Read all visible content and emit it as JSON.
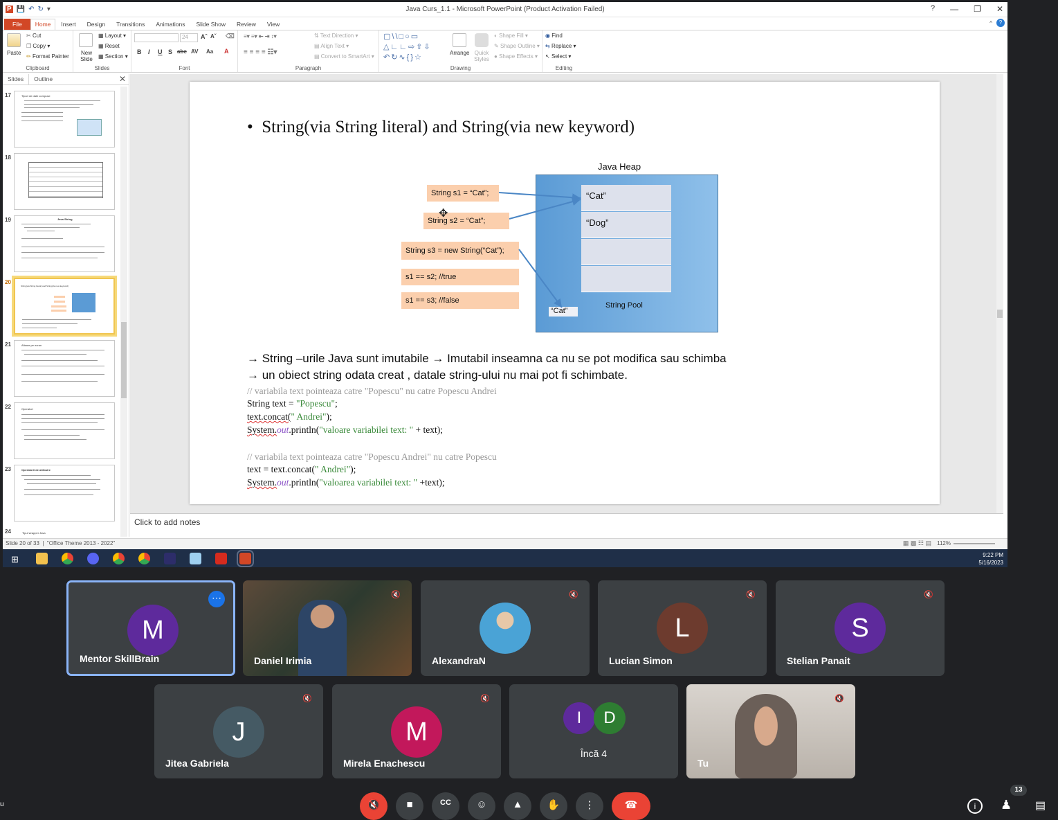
{
  "window": {
    "title": "Java Curs_1.1 - Microsoft PowerPoint (Product Activation Failed)"
  },
  "ribbon": {
    "tabs": [
      "File",
      "Home",
      "Insert",
      "Design",
      "Transitions",
      "Animations",
      "Slide Show",
      "Review",
      "View"
    ],
    "active_tab": "Home",
    "clipboard": {
      "paste": "Paste",
      "cut": "Cut",
      "copy": "Copy",
      "format_painter": "Format Painter",
      "label": "Clipboard"
    },
    "slides": {
      "new_slide": "New Slide",
      "layout": "Layout",
      "reset": "Reset",
      "section": "Section",
      "label": "Slides"
    },
    "font": {
      "size": "24",
      "label": "Font"
    },
    "paragraph": {
      "text_direction": "Text Direction",
      "align_text": "Align Text",
      "convert": "Convert to SmartArt",
      "label": "Paragraph"
    },
    "drawing": {
      "arrange": "Arrange",
      "quick_styles": "Quick Styles",
      "shape_fill": "Shape Fill",
      "shape_outline": "Shape Outline",
      "shape_effects": "Shape Effects",
      "label": "Drawing"
    },
    "editing": {
      "find": "Find",
      "replace": "Replace",
      "select": "Select",
      "label": "Editing"
    }
  },
  "slides_pane": {
    "tabs": [
      "Slides",
      "Outline"
    ],
    "thumbnails": [
      {
        "num": "17",
        "title": "Tipuri de date compuse"
      },
      {
        "num": "18",
        "title": ""
      },
      {
        "num": "19",
        "title": "Java String"
      },
      {
        "num": "20",
        "title": "String(via String literal) and String(via new keyword)"
      },
      {
        "num": "21",
        "title": "Afisare pe ecran"
      },
      {
        "num": "22",
        "title": "Operatori"
      },
      {
        "num": "23",
        "title": "Operatorii de atribuire"
      },
      {
        "num": "24",
        "title": "Tipul wrapper Java"
      }
    ],
    "current": "20"
  },
  "slide": {
    "bullet_title": "String(via  String literal) and String(via new keyword)",
    "diagram": {
      "heap_title": "Java Heap",
      "pool_label": "String Pool",
      "pool_entries": [
        "“Cat”",
        "“Dog”",
        "",
        ""
      ],
      "outside_entry": "“Cat”",
      "statements": [
        "String s1 = “Cat”;",
        "String s2 = “Cat”;",
        "String s3 = new String(“Cat”);",
        "s1 == s2; //true",
        "s1 == s3; //false"
      ]
    },
    "arrow_lines": [
      "→ String –urile Java sunt imutabile → Imutabil inseamna ca nu se pot modifica sau schimba",
      "→ un obiect string odata creat , datale string-ului nu mai pot fi schimbate."
    ],
    "code1": {
      "comment": "// variabila text pointeaza catre \"Popescu\" nu catre Popescu Andrei",
      "line1_a": "String text = ",
      "line1_str": "\"Popescu\"",
      "line1_b": ";",
      "line2_a": "text.concat(",
      "line2_str": "\" Andrei\"",
      "line2_b": ");",
      "line3_a": "System.",
      "line3_out": "out",
      "line3_b": ".println(",
      "line3_str": "\"valoare variabilei text: \"",
      "line3_c": " + text);"
    },
    "code2": {
      "comment": "// variabila text pointeaza catre \"Popescu Andrei\" nu catre Popescu",
      "line1_a": "text = text.concat(",
      "line1_str": "\"  Andrei\"",
      "line1_b": ");",
      "line2_a": "System.",
      "line2_out": "out",
      "line2_b": ".println(",
      "line2_str": "\"valoarea variabilei text: \"",
      "line2_c": " +text);"
    }
  },
  "notes_placeholder": "Click to add notes",
  "status": {
    "slide_info": "Slide 20 of 33",
    "theme": "\"Office Theme 2013 - 2022\"",
    "zoom": "112%"
  },
  "taskbar": {
    "time": "9:22 PM",
    "date": "5/16/2023"
  },
  "meeting": {
    "participants": [
      {
        "name": "Mentor SkillBrain",
        "initial": "M",
        "color": "#5e2a9c",
        "type": "avatar",
        "active": true
      },
      {
        "name": "Daniel Irimia",
        "initial": "",
        "type": "video"
      },
      {
        "name": "AlexandraN",
        "initial": "",
        "type": "photo"
      },
      {
        "name": "Lucian Simon",
        "initial": "L",
        "color": "#6d3b2e",
        "type": "avatar"
      },
      {
        "name": "Stelian Panait",
        "initial": "S",
        "color": "#5e2a9c",
        "type": "avatar"
      },
      {
        "name": "Jitea Gabriela",
        "initial": "J",
        "color": "#455a64",
        "type": "avatar"
      },
      {
        "name": "Mirela Enachescu",
        "initial": "M",
        "color": "#c2185b",
        "type": "avatar"
      },
      {
        "name": "Încă 4",
        "initial": "",
        "type": "group",
        "group_initials": [
          "I",
          "D"
        ],
        "group_colors": [
          "#5e2a9c",
          "#2e7d32"
        ]
      },
      {
        "name": "Tu",
        "initial": "",
        "type": "video"
      }
    ],
    "participant_count": "13"
  }
}
